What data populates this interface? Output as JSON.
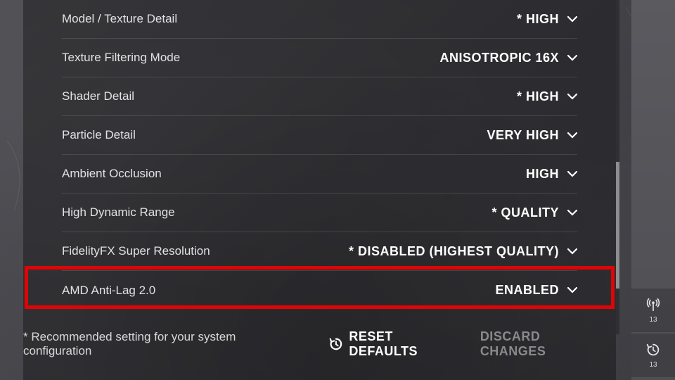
{
  "settings": [
    {
      "label": "Model / Texture Detail",
      "value": "* HIGH"
    },
    {
      "label": "Texture Filtering Mode",
      "value": "ANISOTROPIC 16X"
    },
    {
      "label": "Shader Detail",
      "value": "* HIGH"
    },
    {
      "label": "Particle Detail",
      "value": "VERY HIGH"
    },
    {
      "label": "Ambient Occlusion",
      "value": "HIGH"
    },
    {
      "label": "High Dynamic Range",
      "value": "* QUALITY"
    },
    {
      "label": "FidelityFX Super Resolution",
      "value": "* DISABLED (HIGHEST QUALITY)"
    },
    {
      "label": "AMD Anti-Lag 2.0",
      "value": "ENABLED"
    }
  ],
  "footer": {
    "note": "* Recommended setting for your system configuration",
    "reset": "RESET DEFAULTS",
    "discard": "DISCARD CHANGES"
  },
  "side": {
    "ping_badge": "13",
    "history_badge": "13"
  }
}
